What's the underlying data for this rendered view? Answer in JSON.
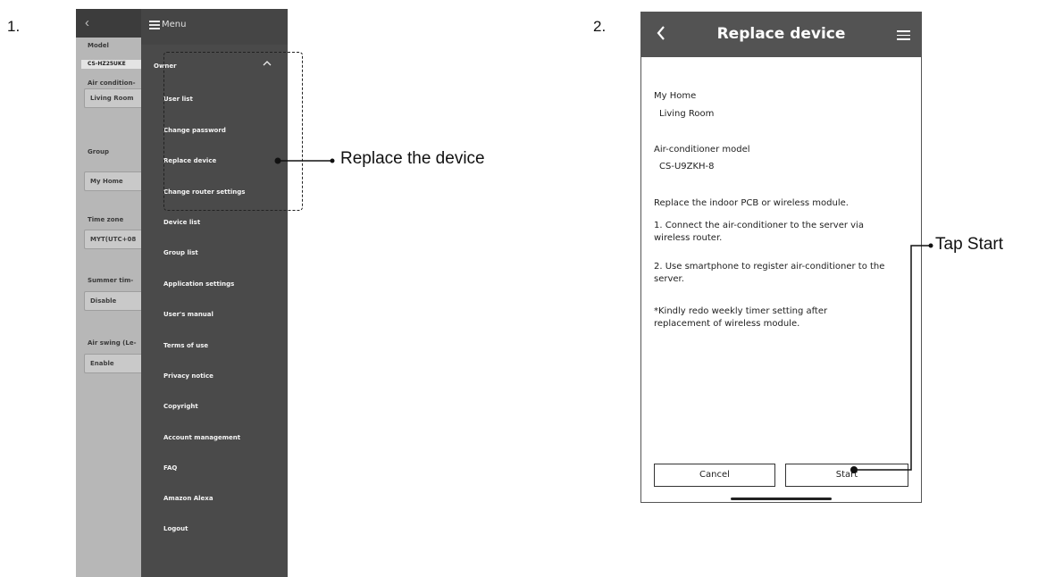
{
  "steps": [
    "1.",
    "2."
  ],
  "screen1": {
    "menu_title": "Menu",
    "owner_label": "Owner",
    "owner_items": [
      "User list",
      "Change password",
      "Replace device",
      "Change router settings"
    ],
    "menu_items": [
      "Device list",
      "Group list",
      "Application settings",
      "User's manual",
      "Terms of use",
      "Privacy notice",
      "Copyright",
      "Account management",
      "FAQ",
      "Amazon Alexa",
      "Logout"
    ],
    "background_fields": [
      {
        "label": "Model",
        "value": "CS-HZ25UKE"
      },
      {
        "label": "Air condition-",
        "value": "Living Room"
      },
      {
        "label": "Group",
        "value": "My Home"
      },
      {
        "label": "Time zone",
        "value": "MYT(UTC+08"
      },
      {
        "label": "Summer tim-",
        "value": "Disable"
      },
      {
        "label": "Air swing (Le-",
        "value": "Enable"
      }
    ]
  },
  "callouts": {
    "replace": "Replace the device",
    "tap_start": "Tap Start"
  },
  "screen2": {
    "title": "Replace device",
    "home_label": "My Home",
    "room": "Living Room",
    "model_label": "Air-conditioner model",
    "model": "CS-U9ZKH-8",
    "instruction": "Replace the indoor PCB or wireless module.",
    "step1": "1. Connect the air-conditioner to the server via wireless router.",
    "step2": "2. Use smartphone to register air-conditioner to the server.",
    "note": "*Kindly redo weekly timer setting after replacement of wireless module.",
    "cancel_label": "Cancel",
    "start_label": "Start"
  }
}
